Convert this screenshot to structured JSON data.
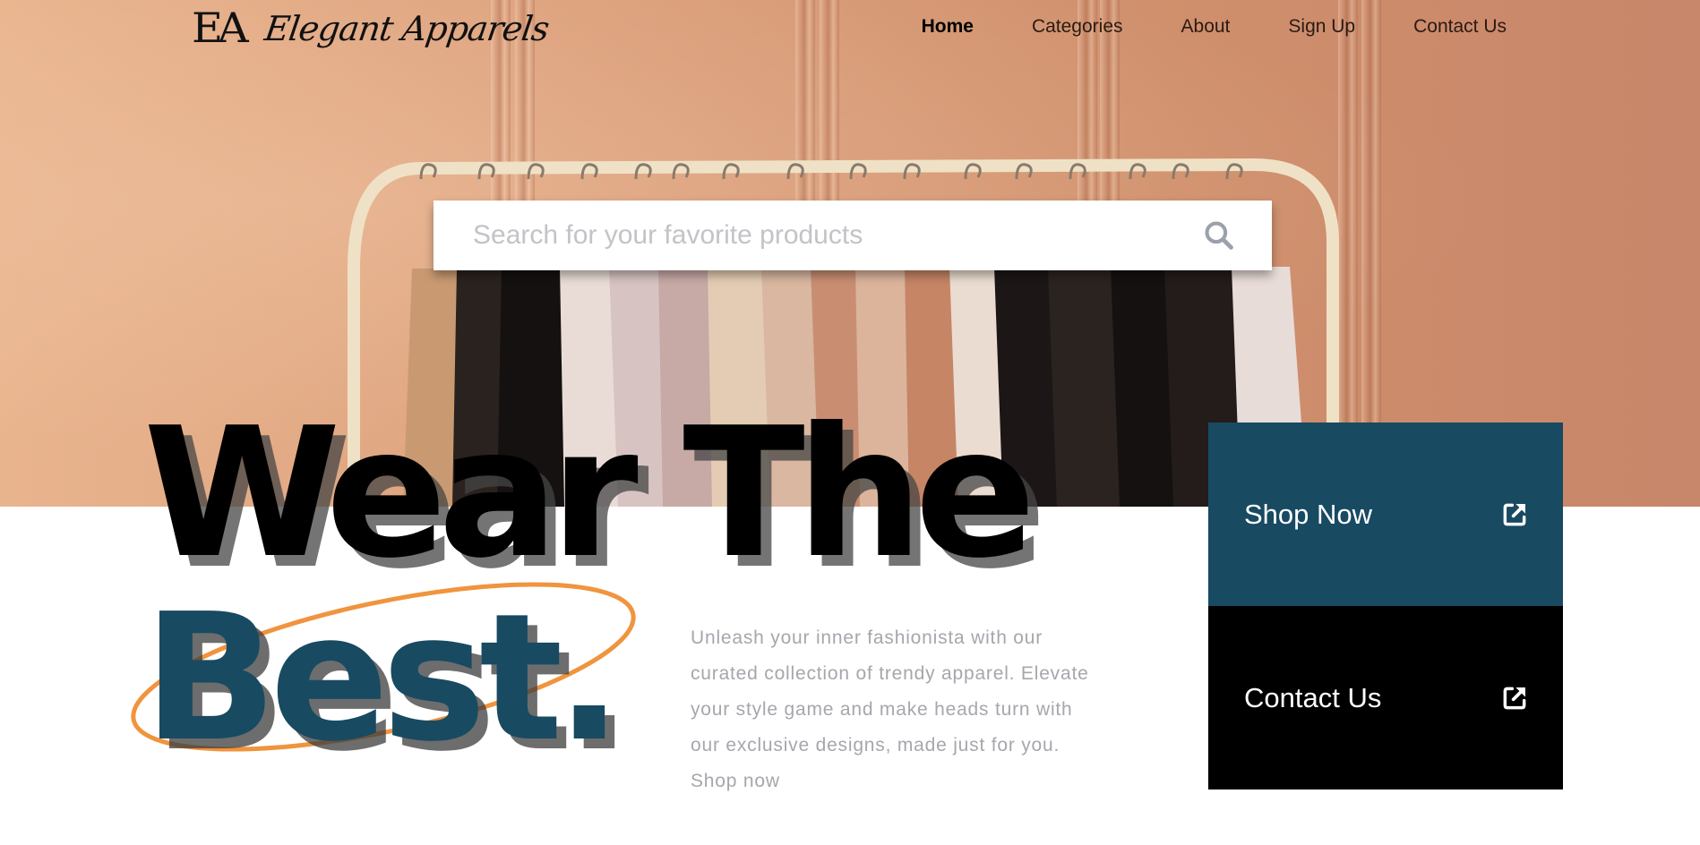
{
  "brand": {
    "monogram": "EA",
    "name": "Elegant Apparels"
  },
  "nav": {
    "items": [
      {
        "label": "Home",
        "active": true
      },
      {
        "label": "Categories",
        "active": false
      },
      {
        "label": "About",
        "active": false
      },
      {
        "label": "Sign Up",
        "active": false
      },
      {
        "label": "Contact Us",
        "active": false
      }
    ]
  },
  "search": {
    "placeholder": "Search for your favorite products",
    "icon": "search-icon"
  },
  "hero": {
    "headline_line1": "Wear The",
    "headline_line2": "Best.",
    "blurb": "Unleash your inner fashionista with our curated collection of trendy apparel. Elevate your style game and make heads turn with our exclusive designs, made just for you. Shop now"
  },
  "cta": {
    "shop": {
      "label": "Shop Now",
      "icon": "external-link-icon"
    },
    "contact": {
      "label": "Contact Us",
      "icon": "external-link-icon"
    }
  },
  "colors": {
    "accent_teal": "#184a62",
    "accent_orange": "#f0943e",
    "text_muted": "#a6a6ad",
    "hero_wall": "#dca07c"
  }
}
